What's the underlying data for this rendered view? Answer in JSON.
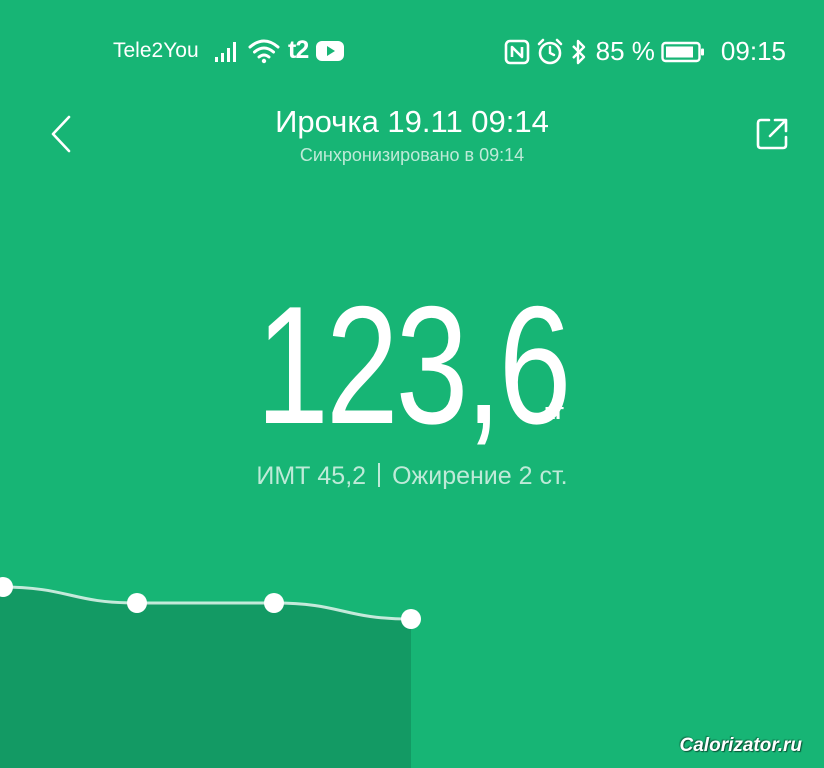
{
  "status_bar": {
    "carrier": "Tele2You",
    "operator_badge": "t2",
    "battery": "85 %",
    "time": "09:15",
    "icons": [
      "signal-icon",
      "wifi-icon",
      "youtube-icon",
      "nfc-icon",
      "alarm-icon",
      "bluetooth-icon",
      "battery-icon"
    ]
  },
  "header": {
    "title": "Ирочка 19.11 09:14",
    "subtitle": "Синхронизировано в 09:14",
    "back_icon": "chevron-left-icon",
    "share_icon": "share-icon"
  },
  "measurement": {
    "value": "123,6",
    "unit": "кг",
    "bmi": "ИМТ 45,2",
    "category": "Ожирение 2 ст."
  },
  "trend": {
    "points": [
      124.2,
      123.9,
      123.9,
      123.6
    ]
  },
  "watermark": "Calorizator.ru",
  "colors": {
    "background": "#17b575",
    "chart_fill": "#139a64",
    "text": "#ffffff"
  }
}
